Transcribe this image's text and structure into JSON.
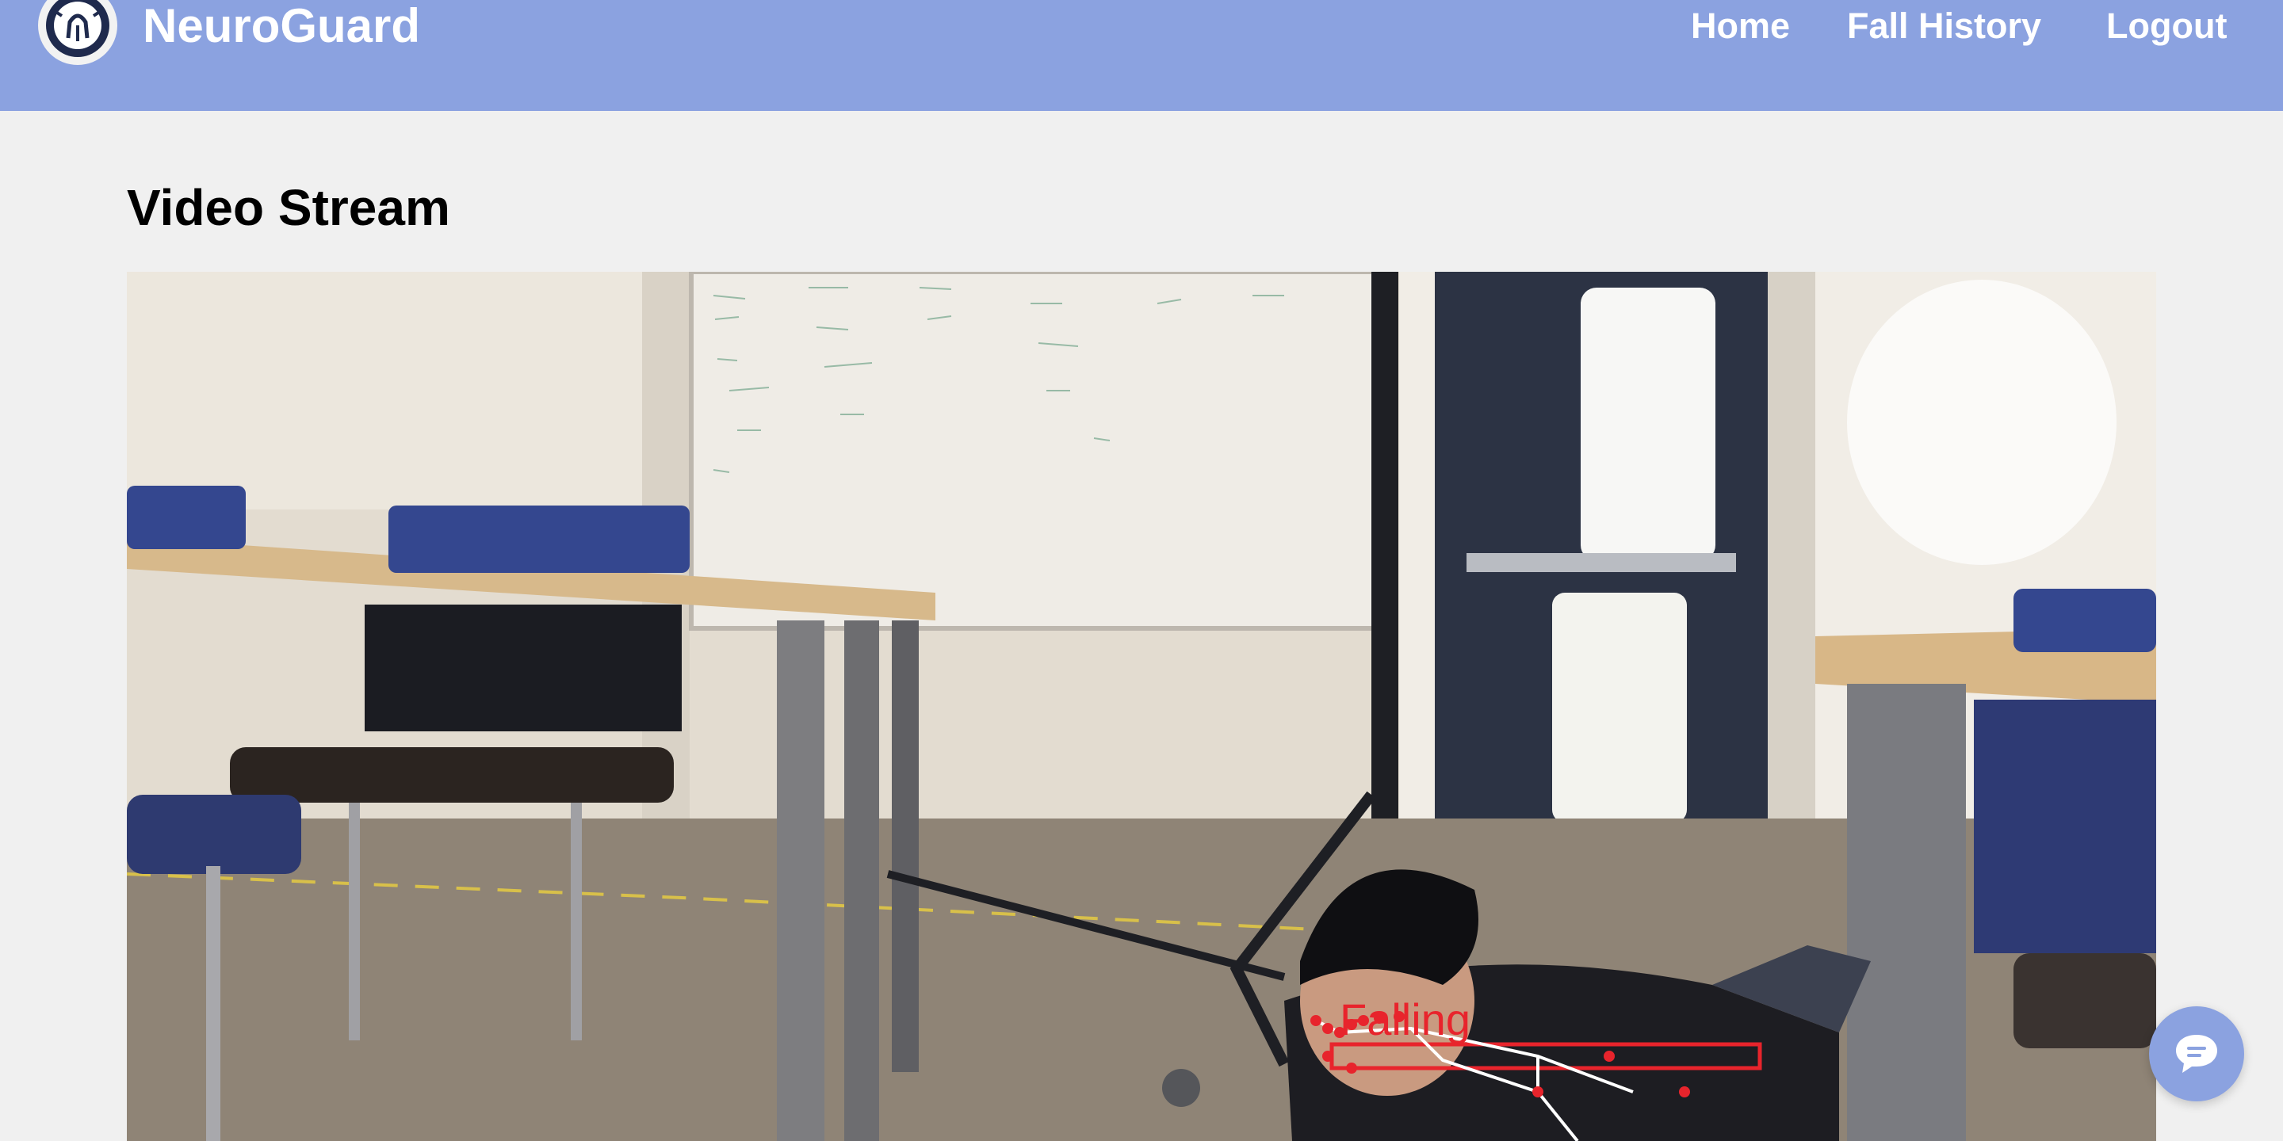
{
  "app": {
    "brand": "NeuroGuard"
  },
  "nav": {
    "home": "Home",
    "fall_history": "Fall History",
    "logout": "Logout"
  },
  "main": {
    "title": "Video Stream",
    "video": {
      "overlay_label": "Falling",
      "overlay_color": "#e8242c"
    }
  },
  "colors": {
    "navbar": "#8ba2e0",
    "page_background": "#f0f0f0",
    "chat_button": "#8ba2e0",
    "logo_ink": "#1f2a4d"
  },
  "icons": {
    "logo": "brain-shield-logo-icon",
    "chat": "chat-bubble-icon"
  }
}
